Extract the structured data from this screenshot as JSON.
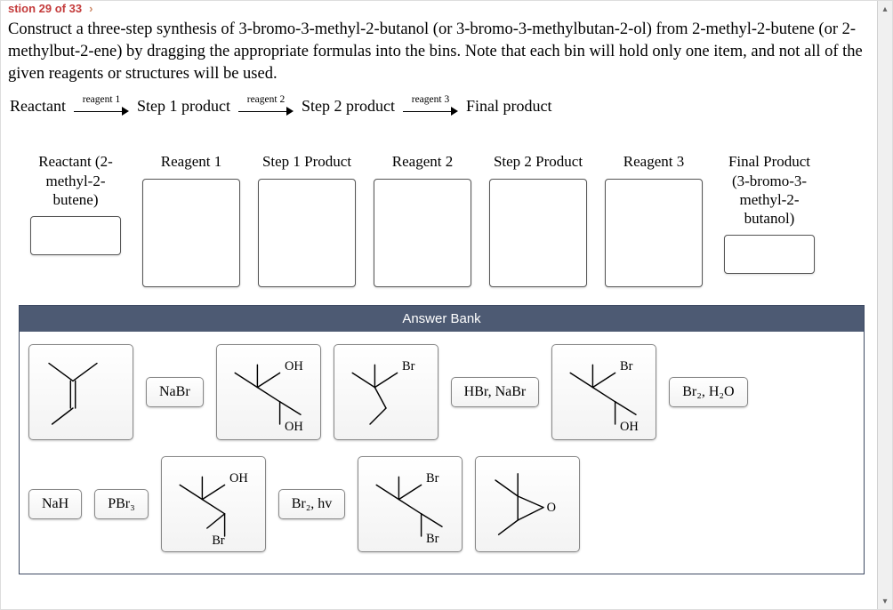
{
  "breadcrumb": {
    "text": "stion 29 of 33",
    "sep": "›"
  },
  "question_text": "Construct a three-step synthesis of 3-bromo-3-methyl-2-butanol (or 3-bromo-3-methylbutan-2-ol) from 2-methyl-2-butene (or 2-methylbut-2-ene) by dragging the appropriate formulas into the bins. Note that each bin will hold only one item, and not all of the given reagents or structures will be used.",
  "scheme": {
    "reactant": "Reactant",
    "r1": "reagent 1",
    "p1": "Step 1 product",
    "r2": "reagent 2",
    "p2": "Step 2 product",
    "r3": "reagent 3",
    "final": "Final product"
  },
  "bins": {
    "b1": {
      "line1": "Reactant (2-",
      "line2": "methyl-2-",
      "line3": "butene)"
    },
    "b2": "Reagent 1",
    "b3": "Step 1 Product",
    "b4": "Reagent 2",
    "b5": "Step 2 Product",
    "b6": "Reagent 3",
    "b7": {
      "line1": "Final Product",
      "line2": "(3-bromo-3-",
      "line3": "methyl-2-",
      "line4": "butanol)"
    }
  },
  "bank": {
    "title": "Answer Bank",
    "items": {
      "nabr": "NaBr",
      "hbr_nabr": "HBr, NaBr",
      "br2_h2o": "Br₂, H₂O",
      "nah": "NaH",
      "pbr3": "PBr₃",
      "br2_hv": "Br₂, hv",
      "labels": {
        "oh": "OH",
        "br": "Br",
        "o": "O"
      }
    }
  }
}
